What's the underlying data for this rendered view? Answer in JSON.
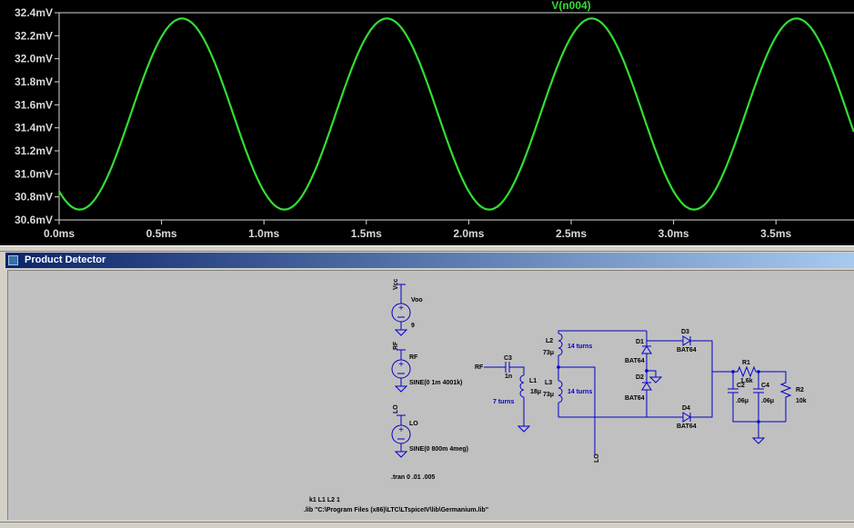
{
  "waveform": {
    "trace_name": "V(n004)",
    "trace_color": "#33dd33",
    "label_color": "#33dd33",
    "y_unit": "mV",
    "x_unit": "ms",
    "y_ticks": [
      "32.4mV",
      "32.2mV",
      "32.0mV",
      "31.8mV",
      "31.6mV",
      "31.4mV",
      "31.2mV",
      "31.0mV",
      "30.8mV",
      "30.6mV"
    ],
    "x_ticks": [
      "0.0ms",
      "0.5ms",
      "1.0ms",
      "1.5ms",
      "2.0ms",
      "2.5ms",
      "3.0ms",
      "3.5ms"
    ]
  },
  "chart_data": {
    "type": "line",
    "series": [
      {
        "name": "V(n004)",
        "values": []
      }
    ],
    "ylim": [
      30.6,
      32.4
    ],
    "xlim_ms": [
      0.0,
      3.9
    ],
    "y_ticks": [
      32.4,
      32.2,
      32.0,
      31.8,
      31.6,
      31.4,
      31.2,
      31.0,
      30.8,
      30.6
    ],
    "x_ticks_ms": [
      0.0,
      0.5,
      1.0,
      1.5,
      2.0,
      2.5,
      3.0,
      3.5
    ],
    "signal": {
      "frequency_hz": 1000,
      "mean_mv": 31.52,
      "amplitude_mv": 0.83,
      "first_peak_ms": 0.6,
      "start_ms": 0.0,
      "end_ms": 3.9
    },
    "grid": false
  },
  "schematic_window": {
    "title": "Product Detector"
  },
  "schematic": {
    "net_vcc": "Vcc",
    "net_rf": "RF",
    "net_lo": "LO",
    "voo": {
      "name": "Voo",
      "value": "9"
    },
    "rf_src": {
      "name": "RF",
      "value": "SINE(0 1m 4001k)"
    },
    "lo_src": {
      "name": "LO",
      "value": "SINE(0 800m 4meg)"
    },
    "tran": ".tran 0 .01 .005",
    "kdirective": "k1 L1 L2 1",
    "lib": ".lib \"C:\\Program Files (x86)\\LTC\\LTspiceIV\\lib\\Germanium.lib\"",
    "c3": {
      "name": "C3",
      "value": "1n"
    },
    "l1": {
      "name": "L1",
      "value": "18μ"
    },
    "l2": {
      "name": "L2",
      "value": "73μ"
    },
    "l3": {
      "name": "L3",
      "value": "73μ"
    },
    "turns_7": "7 turns",
    "turns_14a": "14 turns",
    "turns_14b": "14 turns",
    "d1": {
      "name": "D1",
      "value": "BAT64"
    },
    "d2": {
      "name": "D2",
      "value": "BAT64"
    },
    "d3": {
      "name": "D3",
      "value": "BAT64"
    },
    "d4": {
      "name": "D4",
      "value": "BAT64"
    },
    "r1": {
      "name": "R1",
      "value": "1.6k"
    },
    "r2": {
      "name": "R2",
      "value": "10k"
    },
    "c2": {
      "name": "C2",
      "value": ".06μ"
    },
    "c4": {
      "name": "C4",
      "value": ".06μ"
    }
  }
}
